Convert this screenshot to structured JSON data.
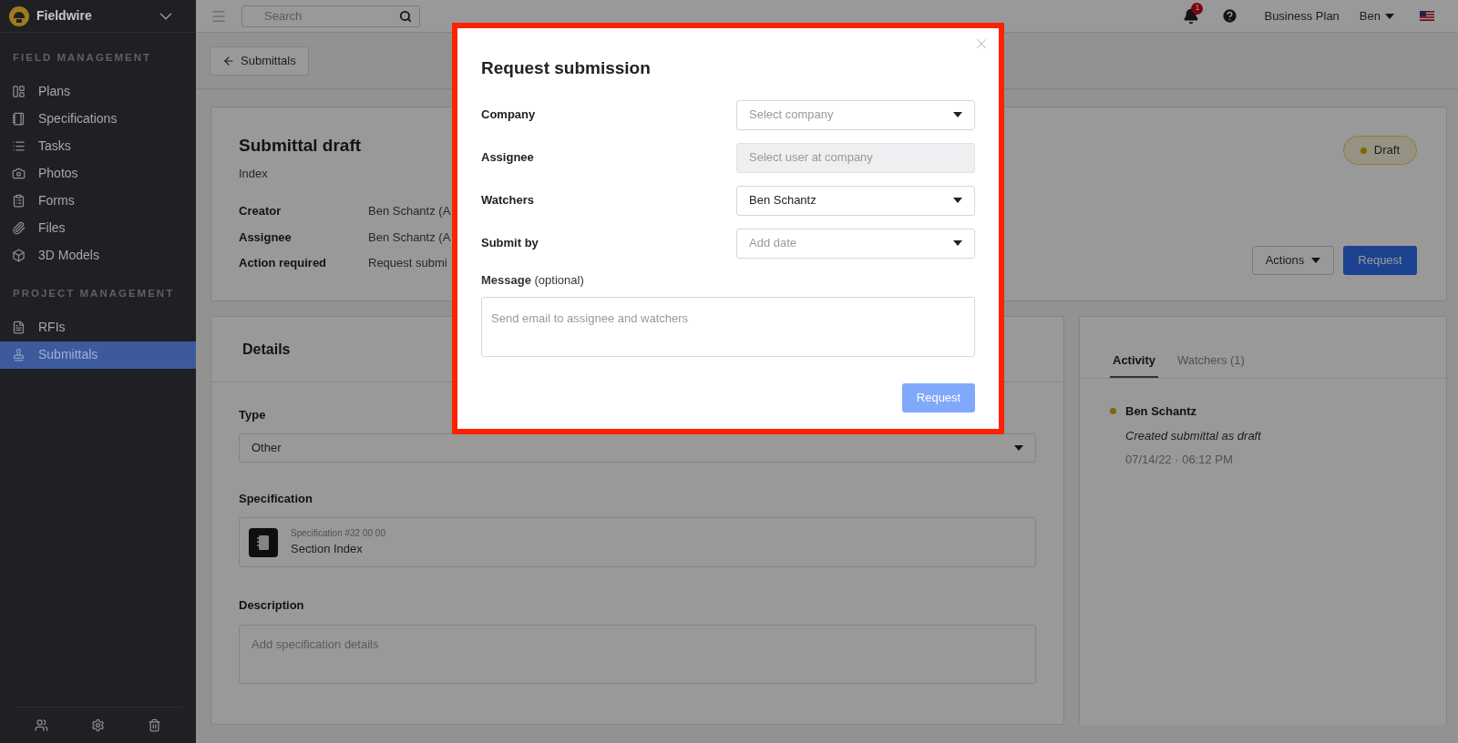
{
  "sidebar": {
    "brand": "Fieldwire",
    "sections": [
      {
        "heading": "FIELD MANAGEMENT",
        "items": [
          {
            "label": "Plans",
            "selected": false
          },
          {
            "label": "Specifications",
            "selected": false
          },
          {
            "label": "Tasks",
            "selected": false
          },
          {
            "label": "Photos",
            "selected": false
          },
          {
            "label": "Forms",
            "selected": false
          },
          {
            "label": "Files",
            "selected": false
          },
          {
            "label": "3D Models",
            "selected": false
          }
        ]
      },
      {
        "heading": "PROJECT MANAGEMENT",
        "items": [
          {
            "label": "RFIs",
            "selected": false
          },
          {
            "label": "Submittals",
            "selected": true
          }
        ]
      }
    ]
  },
  "topbar": {
    "search_placeholder": "Search",
    "notification_count": "1",
    "plan": "Business Plan",
    "user": "Ben"
  },
  "back_button": "Submittals",
  "submittal": {
    "title": "Submittal draft",
    "subtitle": "Index",
    "status": "Draft",
    "fields": [
      {
        "label": "Creator",
        "value": "Ben Schantz (A"
      },
      {
        "label": "Assignee",
        "value": "Ben Schantz (A"
      },
      {
        "label": "Action required",
        "value": "Request submi"
      }
    ],
    "actions_button": "Actions",
    "request_button": "Request"
  },
  "details": {
    "title": "Details",
    "type_label": "Type",
    "type_value": "Other",
    "specification_label": "Specification",
    "spec_number": "Specification #32 00 00",
    "spec_name": "Section Index",
    "description_label": "Description",
    "description_placeholder": "Add specification details"
  },
  "activity": {
    "tabs": [
      {
        "label": "Activity",
        "selected": true
      },
      {
        "label": "Watchers (1)",
        "selected": false
      }
    ],
    "entries": [
      {
        "author": "Ben Schantz",
        "text": "Created submittal as draft",
        "time": "07/14/22 · 06:12 PM"
      }
    ]
  },
  "modal": {
    "title": "Request submission",
    "fields": [
      {
        "label": "Company",
        "placeholder": "Select company",
        "disabled": false
      },
      {
        "label": "Assignee",
        "placeholder": "Select user at company",
        "disabled": true
      },
      {
        "label": "Watchers",
        "value": "Ben Schantz",
        "disabled": false
      },
      {
        "label": "Submit by",
        "placeholder": "Add date",
        "disabled": false
      }
    ],
    "message_label": "**Message** (optional)",
    "message_placeholder": "Send email to assignee and watchers",
    "submit": "Request",
    "submit_disabled": true
  }
}
